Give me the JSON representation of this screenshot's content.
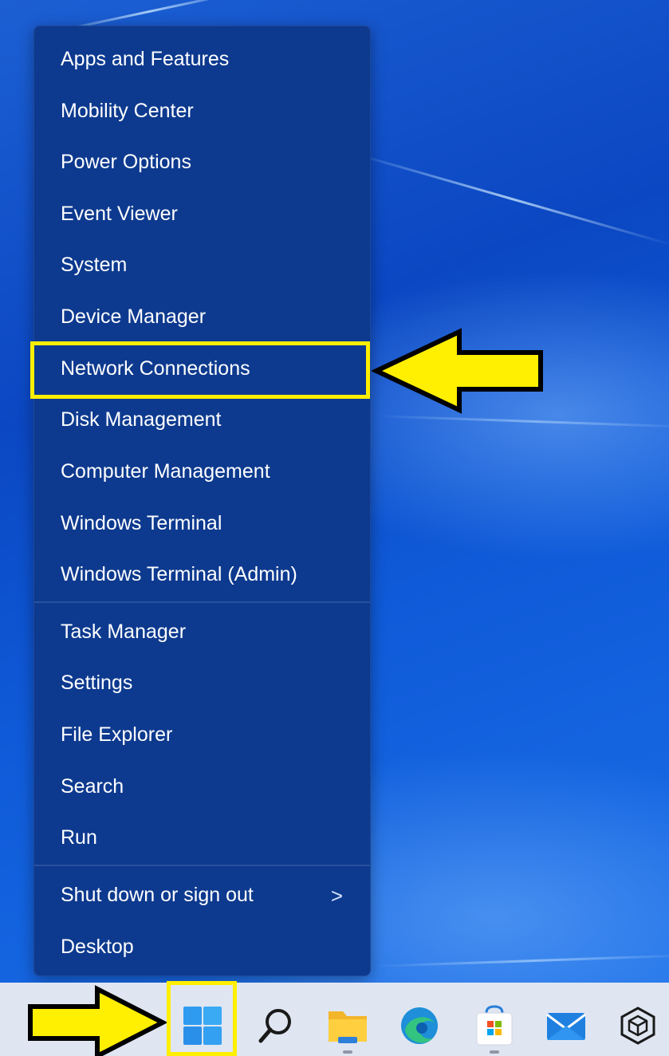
{
  "context_menu": {
    "items": [
      {
        "label": "Apps and Features"
      },
      {
        "label": "Mobility Center"
      },
      {
        "label": "Power Options"
      },
      {
        "label": "Event Viewer"
      },
      {
        "label": "System"
      },
      {
        "label": "Device Manager"
      },
      {
        "label": "Network Connections"
      },
      {
        "label": "Disk Management"
      },
      {
        "label": "Computer Management"
      },
      {
        "label": "Windows Terminal"
      },
      {
        "label": "Windows Terminal (Admin)"
      },
      {
        "label": "Task Manager"
      },
      {
        "label": "Settings"
      },
      {
        "label": "File Explorer"
      },
      {
        "label": "Search"
      },
      {
        "label": "Run"
      },
      {
        "label": "Shut down or sign out",
        "submenu_indicator": ">"
      },
      {
        "label": "Desktop"
      }
    ],
    "highlighted_item": "Network Connections"
  },
  "taskbar": {
    "icons": [
      "start-icon",
      "search-icon",
      "file-explorer-icon",
      "edge-icon",
      "store-icon",
      "mail-icon",
      "app-cube-icon"
    ]
  },
  "colors": {
    "menu_background": "#0d3a8f",
    "annotation_yellow": "#ffef00",
    "taskbar_background": "#dfe6f2"
  }
}
